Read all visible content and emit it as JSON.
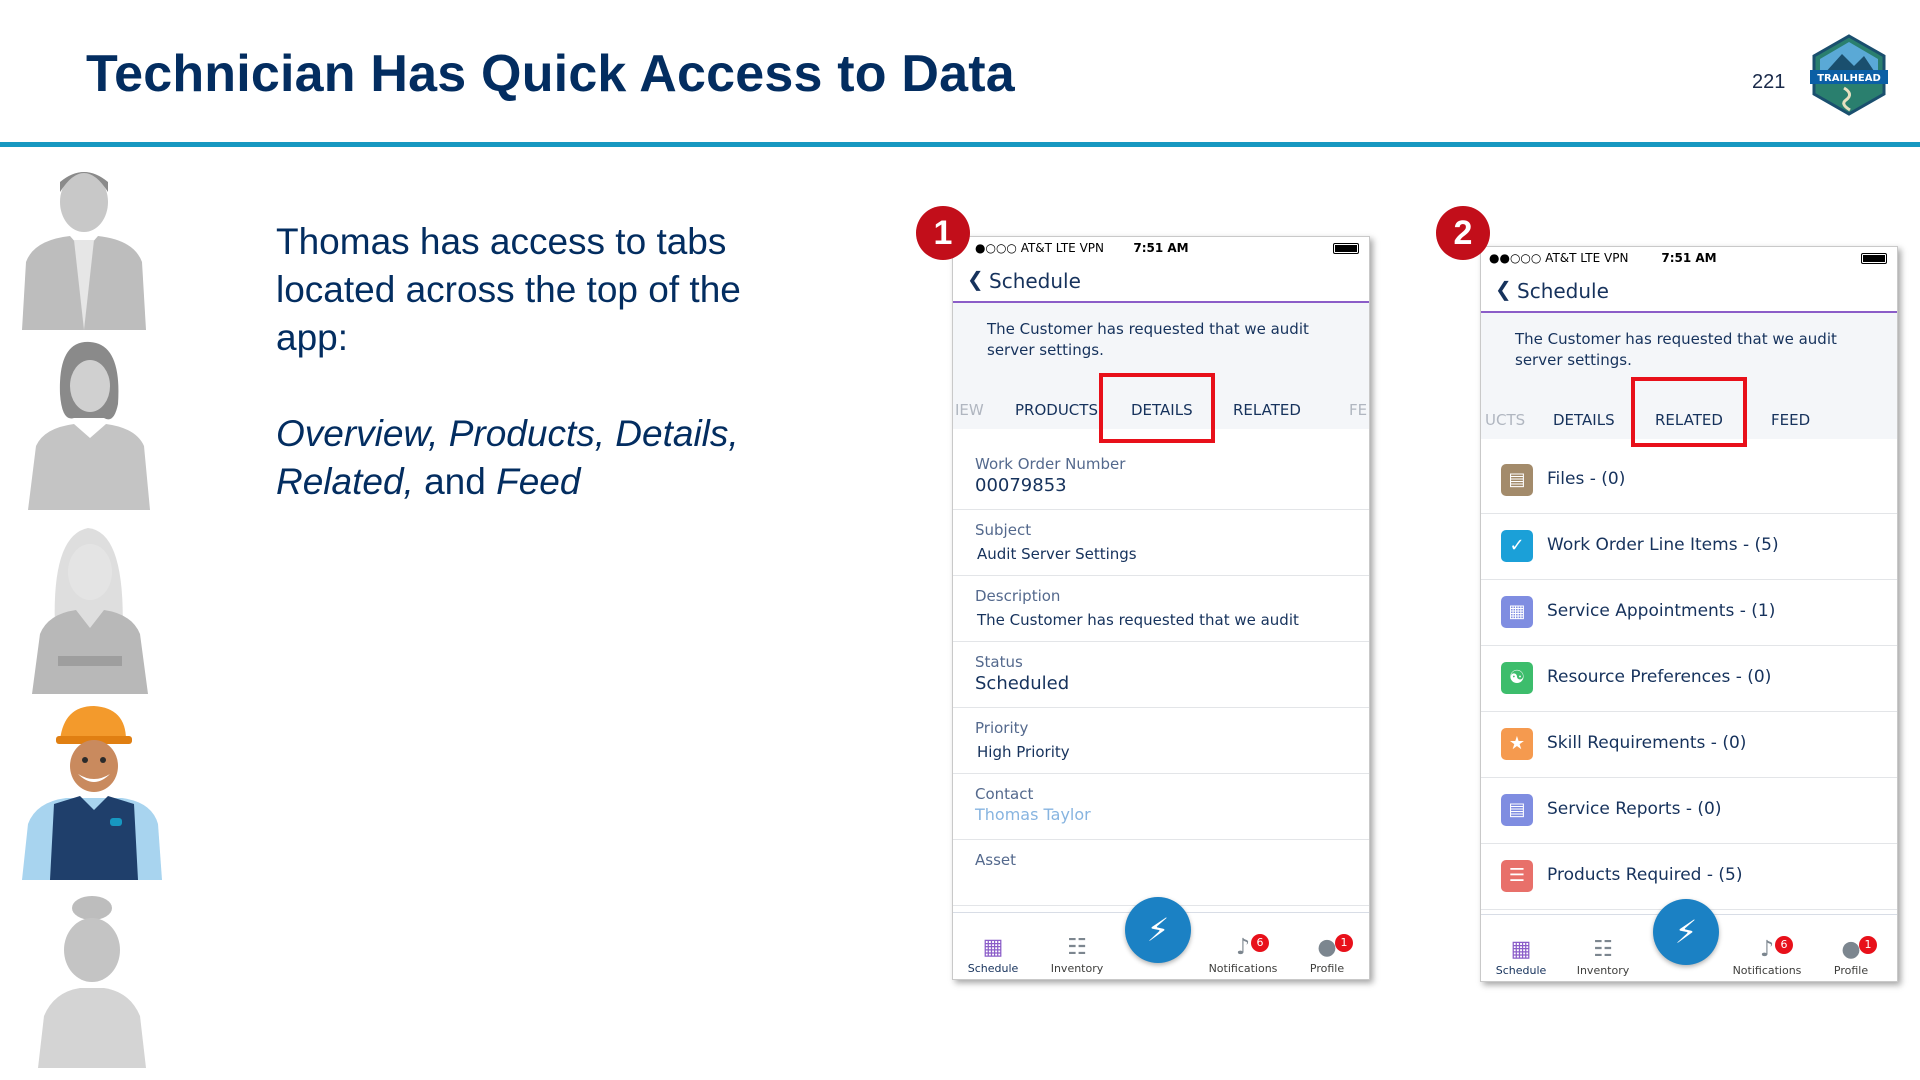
{
  "slide": {
    "title": "Technician Has Quick Access to Data",
    "page_number": "221",
    "logo_text": "TRAILHEAD",
    "body_line1": "Thomas has access to tabs located across the top of the app:",
    "tabs_italic_1": "Overview, Products, Details,",
    "tabs_italic_2": "Related,",
    "tabs_and": " and ",
    "tabs_italic_3": "Feed"
  },
  "phone1": {
    "step": "1",
    "carrier": "●○○○ AT&T  LTE  VPN",
    "time": "7:51 AM",
    "back_label": "Schedule",
    "description": "The Customer has requested that we audit server settings.",
    "tabs": [
      "IEW",
      "PRODUCTS",
      "DETAILS",
      "RELATED",
      "FE"
    ],
    "fields": [
      {
        "label": "Work Order Number",
        "value": "00079853"
      },
      {
        "label": "Subject",
        "value": "Audit Server Settings"
      },
      {
        "label": "Description",
        "value": "The Customer has requested that we audit"
      },
      {
        "label": "Status",
        "value": "Scheduled"
      },
      {
        "label": "Priority",
        "value": "High Priority"
      },
      {
        "label": "Contact",
        "value": "Thomas Taylor"
      },
      {
        "label": "Asset",
        "value": ""
      }
    ]
  },
  "phone2": {
    "step": "2",
    "carrier": "●●○○○ AT&T  LTE  VPN",
    "time": "7:51 AM",
    "back_label": "Schedule",
    "description": "The Customer has requested that we audit server settings.",
    "tabs": [
      "UCTS",
      "DETAILS",
      "RELATED",
      "FEED"
    ],
    "related": [
      {
        "label": "Files - (0)",
        "icon": "file-icon",
        "color": "#a38b6b"
      },
      {
        "label": "Work Order Line Items - (5)",
        "icon": "checklist-icon",
        "color": "#1ba0d8"
      },
      {
        "label": "Service Appointments - (1)",
        "icon": "appointment-icon",
        "color": "#7f8de1"
      },
      {
        "label": "Resource Preferences - (0)",
        "icon": "preference-icon",
        "color": "#3dbd6c"
      },
      {
        "label": "Skill Requirements - (0)",
        "icon": "skill-icon",
        "color": "#f59a4f"
      },
      {
        "label": "Service Reports - (0)",
        "icon": "report-icon",
        "color": "#7f8de1"
      },
      {
        "label": "Products Required - (5)",
        "icon": "products-icon",
        "color": "#e8706a"
      }
    ]
  },
  "bottom_nav": {
    "schedule": "Schedule",
    "inventory": "Inventory",
    "notifications": "Notifications",
    "profile": "Profile",
    "notif_badge": "6",
    "profile_badge": "1"
  },
  "colors": {
    "title": "#032d60",
    "rule": "#1798c1",
    "highlight": "#e8101a",
    "accent_purple": "#8b5dc8",
    "fab_blue": "#1b81c4"
  }
}
